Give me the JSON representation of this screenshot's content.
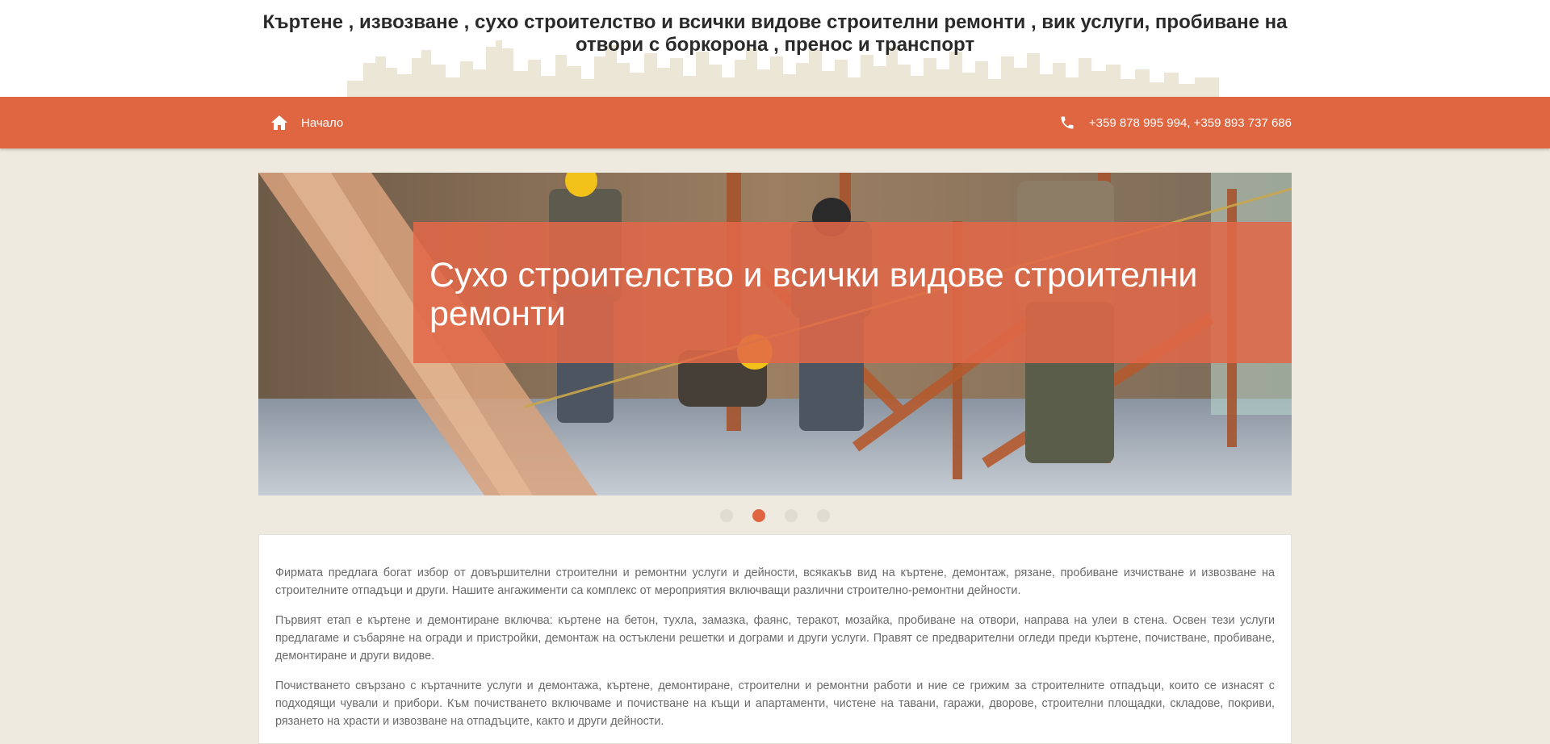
{
  "header": {
    "title": "Къртене , извозване , сухо строителство и всички видове строителни ремонти , вик услуги, пробиване на отвори с боркорона , пренос и транспорт"
  },
  "nav": {
    "home_label": "Начало",
    "home_icon": "home-icon",
    "phone_label": "+359 878 995 994, +359 893 737 686",
    "phone_icon": "phone-icon"
  },
  "slider": {
    "caption": "Сухо строителство и всички видове строителни ремонти",
    "slide_count": 4,
    "active_index": 1
  },
  "content": {
    "paragraphs": [
      "Фирмата предлага богат избор от довършителни строителни и ремонтни услуги и дейности, всякакъв вид на къртене, демонтаж, рязане, пробиване изчистване и извозване на строителните отпадъци и други. Нашите ангажименти са комплекс от мероприятия включващи различни строително-ремонтни дейности.",
      "Първият етап е къртене и демонтиране включва: къртене на бетон, тухла, замазка, фаянс, теракот, мозайка, пробиване на отвори, направа на улеи в стена. Освен тези услуги предлагаме и събаряне на огради и пристройки, демонтаж на остъклени решетки и дограми и други услуги. Правят се предварителни огледи преди къртене, почистване, пробиване, демонтиране и други видове.",
      "Почистването свързано с къртачните услуги и демонтажа, къртене, демонтиране, строителни и ремонтни работи и ние се грижим за строителните отпадъци, които се изнасят с подходящи чували и прибори. Към почистването включваме и почистване на къщи и апартаменти, чистене на тавани, гаражи, дворове, строителни площадки, складове, покриви, рязането на храсти и извозване на отпадъците, както и други дейности."
    ]
  },
  "colors": {
    "accent": "#e06641",
    "page_background": "#efeadf",
    "skyline": "#ece6d7",
    "dot_inactive": "#e0dcd2"
  }
}
